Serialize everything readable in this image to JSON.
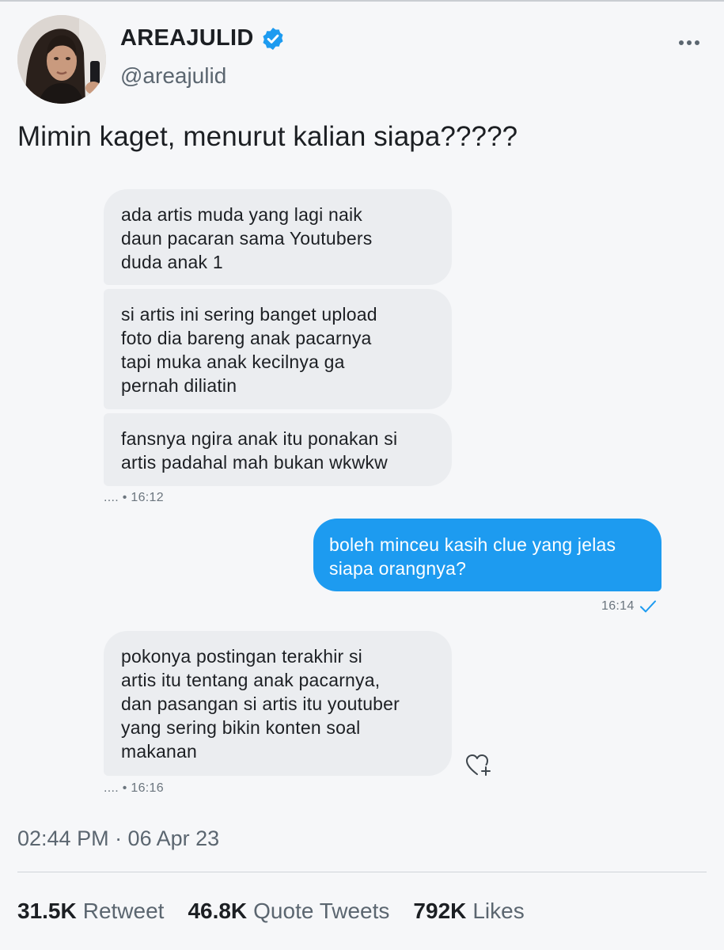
{
  "tweet": {
    "author": {
      "display_name": "AREAJULID",
      "handle": "@areajulid",
      "verified": true
    },
    "text": "Mimin kaget, menurut kalian siapa?????",
    "timestamp": "02:44 PM · 06 Apr 23",
    "stats": [
      {
        "count": "31.5K",
        "label": "Retweet"
      },
      {
        "count": "46.8K",
        "label": "Quote Tweets"
      },
      {
        "count": "792K",
        "label": "Likes"
      }
    ]
  },
  "dm": {
    "messages": [
      {
        "direction": "in",
        "lines": [
          "ada artis muda yang lagi naik",
          "daun pacaran sama Youtubers",
          "duda anak 1"
        ]
      },
      {
        "direction": "in",
        "lines": [
          "si artis ini sering banget upload",
          "foto dia bareng anak pacarnya",
          "tapi muka anak kecilnya ga",
          "pernah diliatin"
        ]
      },
      {
        "direction": "in",
        "lines": [
          "fansnya ngira anak itu ponakan si",
          "artis padahal mah bukan wkwkw"
        ]
      },
      {
        "direction": "out",
        "lines": [
          "boleh minceu kasih clue yang jelas",
          "siapa orangnya?"
        ]
      },
      {
        "direction": "in",
        "lines": [
          "pokonya postingan terakhir si",
          "artis itu tentang anak pacarnya,",
          "dan pasangan si artis itu youtuber",
          "yang sering bikin konten soal",
          "makanan"
        ]
      }
    ],
    "meta": [
      {
        "prefix": "....",
        "sep": "•",
        "time": "16:12"
      },
      {
        "time": "16:14",
        "status": "check-icon"
      },
      {
        "prefix": "....",
        "sep": "•",
        "time": "16:16"
      }
    ]
  },
  "icons": {
    "verified": "verified-badge-icon",
    "more": "more-options-icon",
    "read": "check-icon",
    "react": "heart-plus-icon"
  },
  "colors": {
    "accent": "#1d9bf0",
    "incoming_bubble": "#ebedf0",
    "background": "#f6f7f9"
  }
}
